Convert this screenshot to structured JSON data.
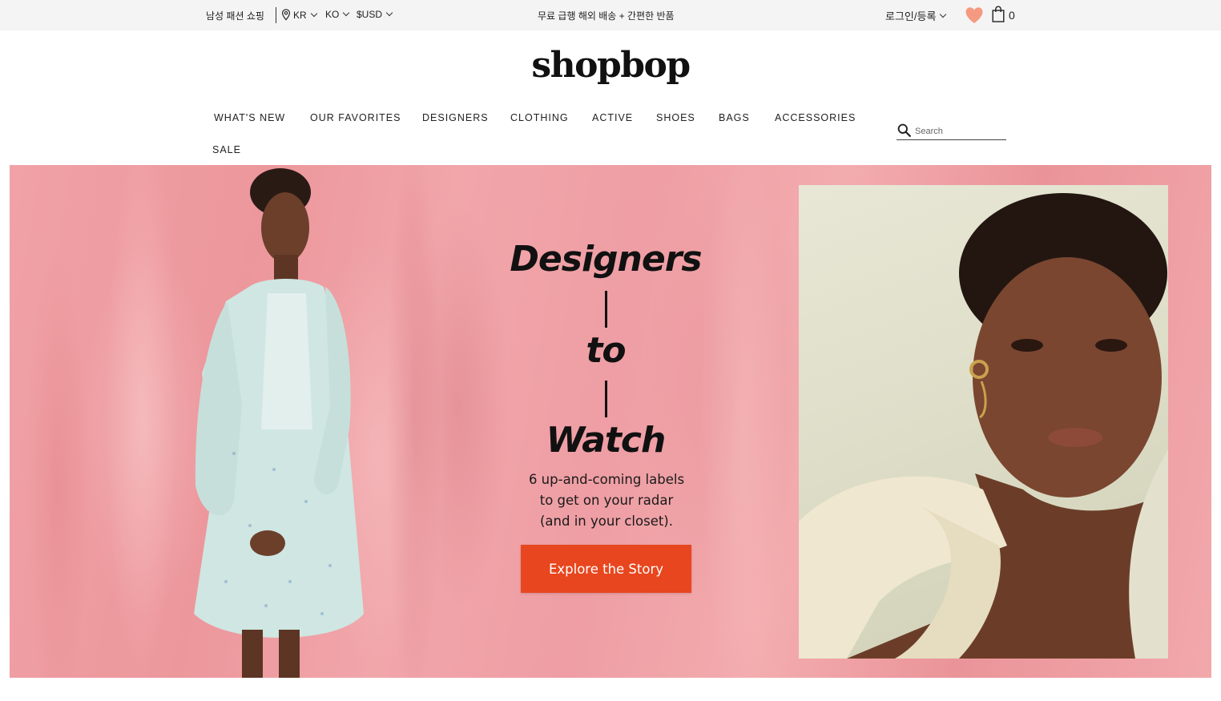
{
  "topbar": {
    "mens_link": "남성 패션 쇼핑",
    "country": "KR",
    "language": "KO",
    "currency": "$USD",
    "promo": "무료 급행 해외 배송 + 간편한 반품",
    "login": "로그인/등록",
    "bag_count": "0"
  },
  "header": {
    "logo": "shopbop"
  },
  "nav": {
    "items": [
      "WHAT'S NEW",
      "OUR FAVORITES",
      "DESIGNERS",
      "CLOTHING",
      "ACTIVE",
      "SHOES",
      "BAGS",
      "ACCESSORIES",
      "SALE"
    ],
    "search_placeholder": "Search"
  },
  "hero": {
    "headline_1": "Designers",
    "headline_2": "to",
    "headline_3": "Watch",
    "sub_line_1": "6 up-and-coming labels",
    "sub_line_2": "to get on your radar",
    "sub_line_3": "(and in your closet).",
    "cta": "Explore the Story"
  },
  "colors": {
    "accent_heart": "#f59a80",
    "cta_orange": "#e8461e",
    "banner_pink": "#f0a2a6",
    "photo_bg": "#dcdcc6"
  },
  "icons": [
    "location-pin-icon",
    "chevron-down-icon",
    "heart-icon",
    "shopping-bag-icon",
    "search-icon"
  ]
}
